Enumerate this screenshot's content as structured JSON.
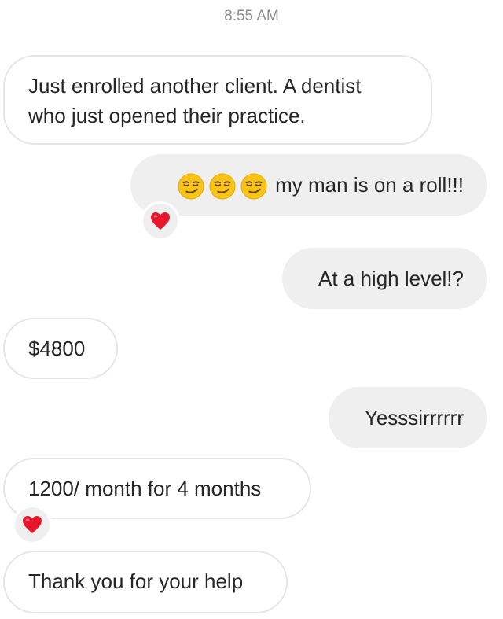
{
  "header": {
    "timestamp": "8:55 AM"
  },
  "messages": [
    {
      "direction": "incoming",
      "line1": "Just enrolled another client. A dentist",
      "line2": "who just opened their practice."
    },
    {
      "direction": "outgoing",
      "emojis": [
        "smirking-face",
        "smirking-face",
        "smirking-face"
      ],
      "text": "my man is on a roll!!!",
      "reaction": "red-heart"
    },
    {
      "direction": "outgoing",
      "text": "At a high level!?"
    },
    {
      "direction": "incoming",
      "text": "$4800"
    },
    {
      "direction": "outgoing",
      "text": "Yesssirrrrrr"
    },
    {
      "direction": "incoming",
      "text": "1200/ month for 4 months",
      "reaction": "red-heart"
    },
    {
      "direction": "incoming",
      "text": "Thank you for your help"
    }
  ],
  "colors": {
    "incoming_border": "#e6e6e6",
    "outgoing_bg": "#efefef",
    "text": "#262626",
    "timestamp": "#8e8e8e",
    "heart": "#e8162a",
    "emoji_face": "#f8c417"
  }
}
